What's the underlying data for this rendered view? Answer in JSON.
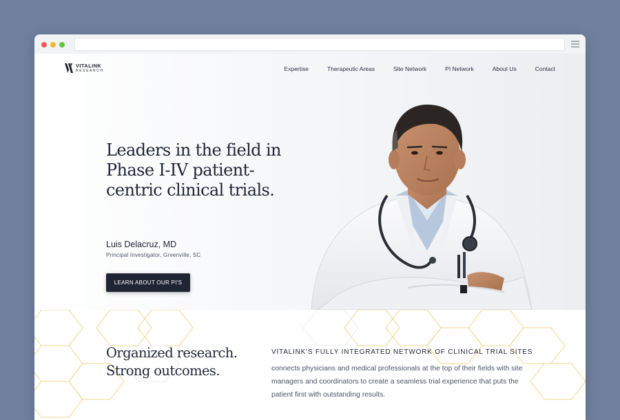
{
  "brand": {
    "name": "VITALINK",
    "sub": "RESEARCH",
    "icon": "vitalink-logo-mark"
  },
  "nav": {
    "items": [
      "Expertise",
      "Therapeutic Areas",
      "Site Network",
      "PI Network",
      "About Us",
      "Contact"
    ]
  },
  "hero": {
    "headline": "Leaders in the field in Phase I-IV patient-centric clinical trials.",
    "person_name": "Luis Delacruz, MD",
    "person_title": "Principal Investigator, Greenville, SC",
    "cta_label": "LEARN ABOUT OUR PI'S"
  },
  "section": {
    "tagline": "Organized research. Strong outcomes.",
    "lead_heading": "VITALINK'S FULLY INTEGRATED NETWORK OF CLINICAL TRIAL SITES",
    "lead_body": "connects physicians and medical professionals at the top of their fields with site managers and coordinators to create a seamless trial experience that puts the patient first with outstanding results."
  },
  "colors": {
    "page_bg": "#6f809f",
    "text_dark": "#1f2533",
    "button_bg": "#1f2533",
    "hex_accent": "#f0d48a"
  }
}
